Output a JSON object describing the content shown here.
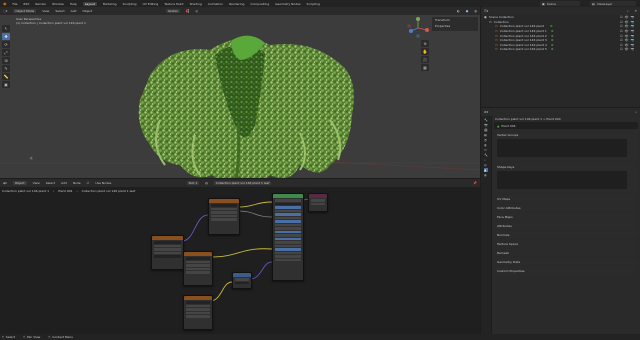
{
  "topbar": {
    "menus": [
      "File",
      "Edit",
      "Render",
      "Window",
      "Help"
    ],
    "workspaces": [
      "Layout",
      "Modeling",
      "Sculpting",
      "UV Editing",
      "Texture Paint",
      "Shading",
      "Animation",
      "Rendering",
      "Compositing",
      "Geometry Nodes",
      "Scripting"
    ],
    "active_workspace": "Layout",
    "scene": "Scene",
    "view_layer": "ViewLayer"
  },
  "viewport": {
    "mode": "Object Mode",
    "menus": [
      "View",
      "Select",
      "Add",
      "Object"
    ],
    "transform_orientation": "Global",
    "title": "User Perspective",
    "subtitle": "(1) Collection | Collection plant vol 146 plant 1",
    "npanel": {
      "item1": "Transform",
      "item2": "Properties"
    }
  },
  "node_editor": {
    "type": "Object",
    "menus": [
      "View",
      "Select",
      "Add",
      "Node"
    ],
    "use_nodes": "Use Nodes",
    "slot": "Slot 1",
    "material": "Collection plant vol 146 plant 1 leaf",
    "breadcrumb": [
      "Collection plant vol 146 plant 1",
      "Plant 004",
      "Collection plant vol 146 plant 1 leaf"
    ]
  },
  "outliner": {
    "header": "Scene Collection",
    "rows": [
      {
        "name": "Scene Collection",
        "level": 0
      },
      {
        "name": "Collection",
        "level": 1
      },
      {
        "name": "Collection plant vol 146 plant",
        "level": 2
      },
      {
        "name": "Collection plant vol 146 plant 1",
        "level": 2
      },
      {
        "name": "Collection plant vol 146 plant 2",
        "level": 2
      },
      {
        "name": "Collection plant vol 146 plant 3",
        "level": 2
      },
      {
        "name": "Collection plant vol 146 plant 4",
        "level": 2
      },
      {
        "name": "Collection plant vol 146 plant 5",
        "level": 2
      }
    ]
  },
  "properties": {
    "breadcrumb": "Collection plant vol 146 plant 1 > Plant 004",
    "object_name": "Plant 004",
    "sections": [
      "Vertex Groups",
      "Shape Keys",
      "UV Maps",
      "Color Attributes",
      "Face Maps",
      "Attributes",
      "Normals",
      "Texture Space",
      "Remesh",
      "Geometry Data",
      "Custom Properties"
    ],
    "open_section_1": "Vertex Groups",
    "open_section_2": "Shape Keys",
    "attributes_header": "Attributes",
    "panels": [
      "Geometry Nodes"
    ]
  },
  "statusbar": {
    "left": "Select",
    "mid": "Pan View",
    "right": "Context Menu"
  },
  "colors": {
    "accent": "#4b70a8",
    "node_green": "#3f8a4a",
    "node_orange": "#8a4f1f",
    "node_purple": "#5a2a45",
    "node_blue": "#3a5d8c",
    "wire_yellow": "#c9b93a",
    "wire_purple": "#6b5fd4"
  }
}
